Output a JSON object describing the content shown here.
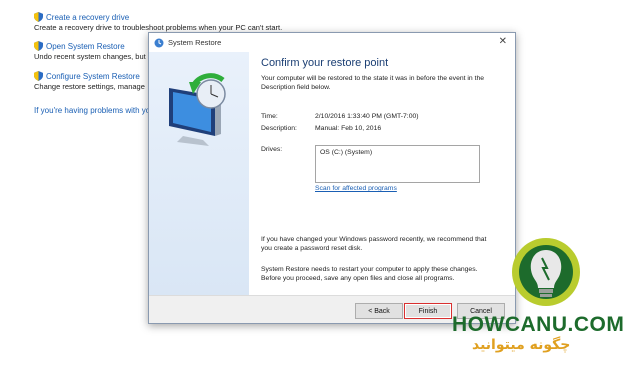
{
  "background": {
    "items": [
      {
        "link": "Create a recovery drive",
        "desc": "Create a recovery drive to troubleshoot problems when your PC can't start."
      },
      {
        "link": "Open System Restore",
        "desc": "Undo recent system changes, but"
      },
      {
        "link": "Configure System Restore",
        "desc": "Change restore settings, manage"
      }
    ],
    "help_link": "If you're having problems with you"
  },
  "dialog": {
    "title": "System Restore",
    "heading": "Confirm your restore point",
    "intro": "Your computer will be restored to the state it was in before the event in the Description field below.",
    "time_label": "Time:",
    "time_value": "2/10/2016 1:33:40 PM (GMT-7:00)",
    "description_label": "Description:",
    "description_value": "Manual: Feb 10, 2016",
    "drives_label": "Drives:",
    "drives_value": "OS (C:) (System)",
    "scan_link": "Scan for affected programs",
    "password_note": "If you have changed your Windows password recently, we recommend that you create a password reset disk.",
    "restart_note": "System Restore needs to restart your computer to apply these changes. Before you proceed, save any open files and close all programs.",
    "buttons": {
      "back": "< Back",
      "finish": "Finish",
      "cancel": "Cancel"
    }
  },
  "watermark": {
    "brand": "HOWCANU.COM",
    "tagline": "چگونه میتوانید"
  }
}
